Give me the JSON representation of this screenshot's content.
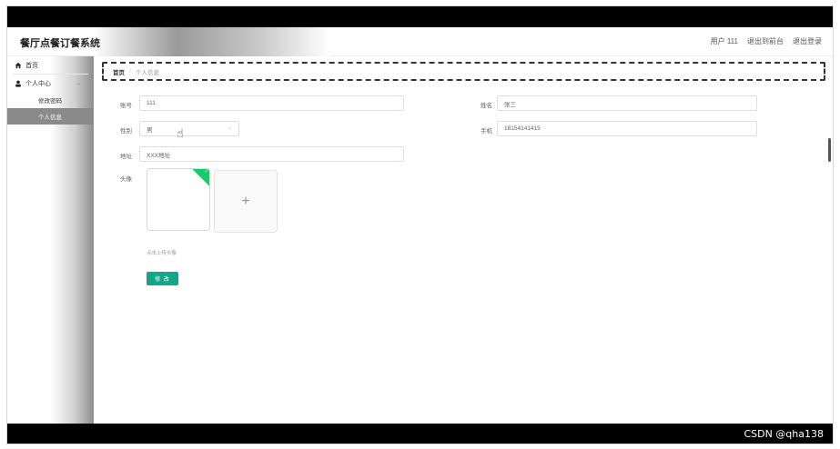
{
  "header": {
    "app_title": "餐厅点餐订餐系统",
    "user_label": "用户 111",
    "go_front_label": "退出到前台",
    "logout_label": "退出登录"
  },
  "sidebar": {
    "items": [
      {
        "label": "首页",
        "icon": "home-icon"
      },
      {
        "label": "个人中心",
        "icon": "user-icon"
      }
    ],
    "sub_items": [
      {
        "label": "修改密码",
        "active": false
      },
      {
        "label": "个人信息",
        "active": true
      }
    ]
  },
  "breadcrumb": {
    "home": "首页",
    "separator": "/",
    "current": "个人信息"
  },
  "form": {
    "account_label": "账号",
    "account_value": "111",
    "name_label": "姓名",
    "name_value": "张三",
    "gender_label": "性别",
    "gender_value": "男",
    "phone_label": "手机",
    "phone_value": "18154141415",
    "address_label": "地址",
    "address_value": "XXX地址",
    "avatar_label": "头像",
    "upload_plus": "+",
    "upload_tip": "点击上传头像",
    "submit_label": "修 改"
  },
  "watermark": "CSDN @qha138",
  "colors": {
    "accent": "#13a78a",
    "success_corner": "#13ce66",
    "active_menu_bg": "#8a8a8a"
  }
}
